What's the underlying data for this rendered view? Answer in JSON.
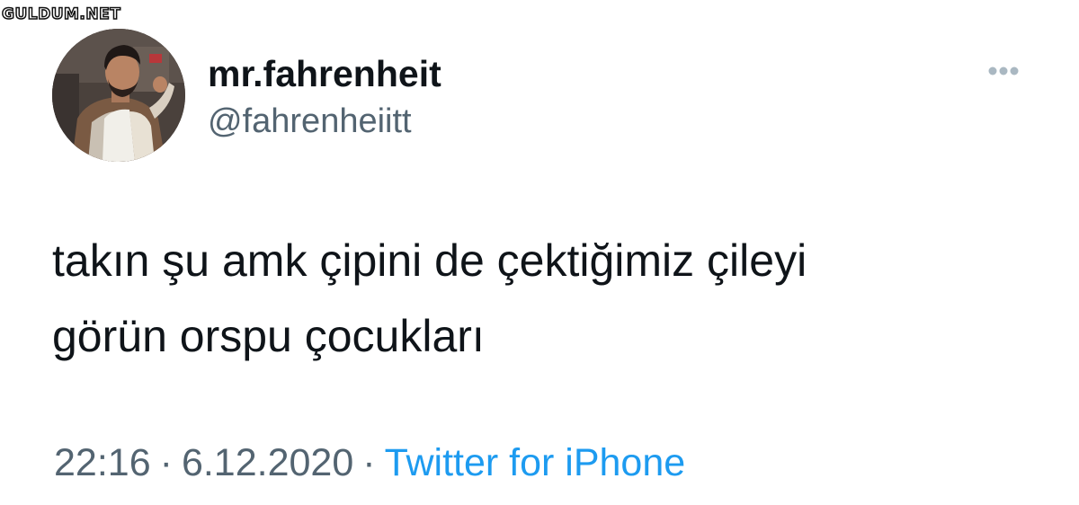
{
  "watermark": {
    "text": "GULDUM.NET"
  },
  "tweet": {
    "author": {
      "display_name": "mr.fahrenheit",
      "handle": "@fahrenheiitt",
      "avatar": "profile-photo"
    },
    "more_icon": "more-horizontal-icon",
    "text": "takın şu amk çipini de çektiğimiz çileyi\ngörün orspu çocukları",
    "time": "22:16",
    "date": "6.12.2020",
    "separator": "·",
    "source": "Twitter for iPhone"
  },
  "colors": {
    "text_primary": "#0f1419",
    "text_secondary": "#536471",
    "link": "#1d9bf0",
    "background": "#ffffff",
    "more_dots": "#aab8c2"
  }
}
